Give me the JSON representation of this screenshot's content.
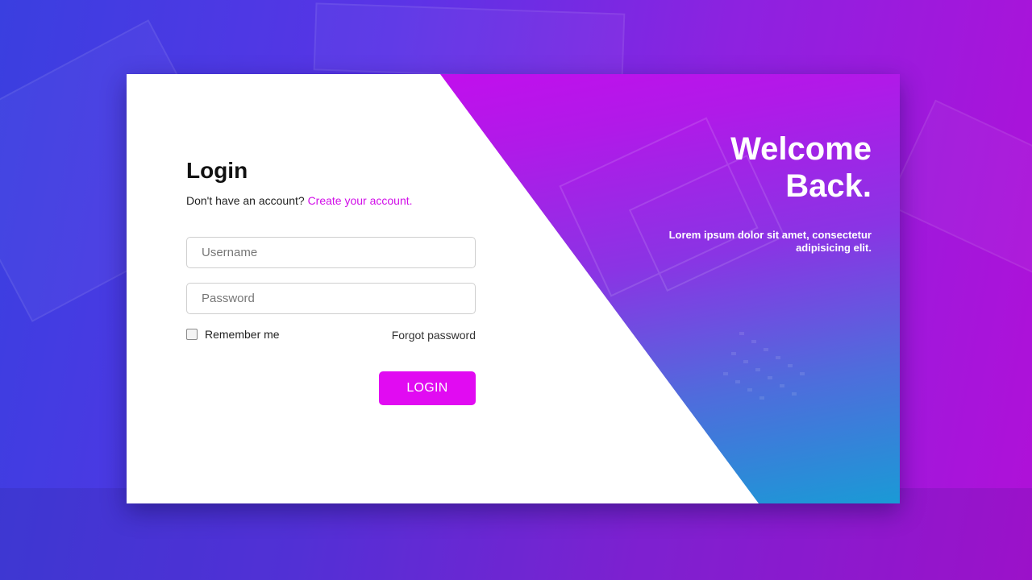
{
  "login": {
    "title": "Login",
    "signup_prompt": "Don't have an account?",
    "signup_link": "Create your account.",
    "username_placeholder": "Username",
    "password_placeholder": "Password",
    "remember_label": "Remember me",
    "forgot_label": "Forgot password",
    "submit_label": "LOGIN"
  },
  "welcome": {
    "title": "Welcome\nBack.",
    "text": "Lorem ipsum dolor sit amet, consectetur adipisicing elit."
  },
  "colors": {
    "accent": "#e10bf2",
    "link": "#d10ee8",
    "gradient_top": "#cc08f0",
    "gradient_bottom": "#1a9ad6"
  },
  "icons": {
    "remember_checkbox": "checkbox-icon"
  }
}
